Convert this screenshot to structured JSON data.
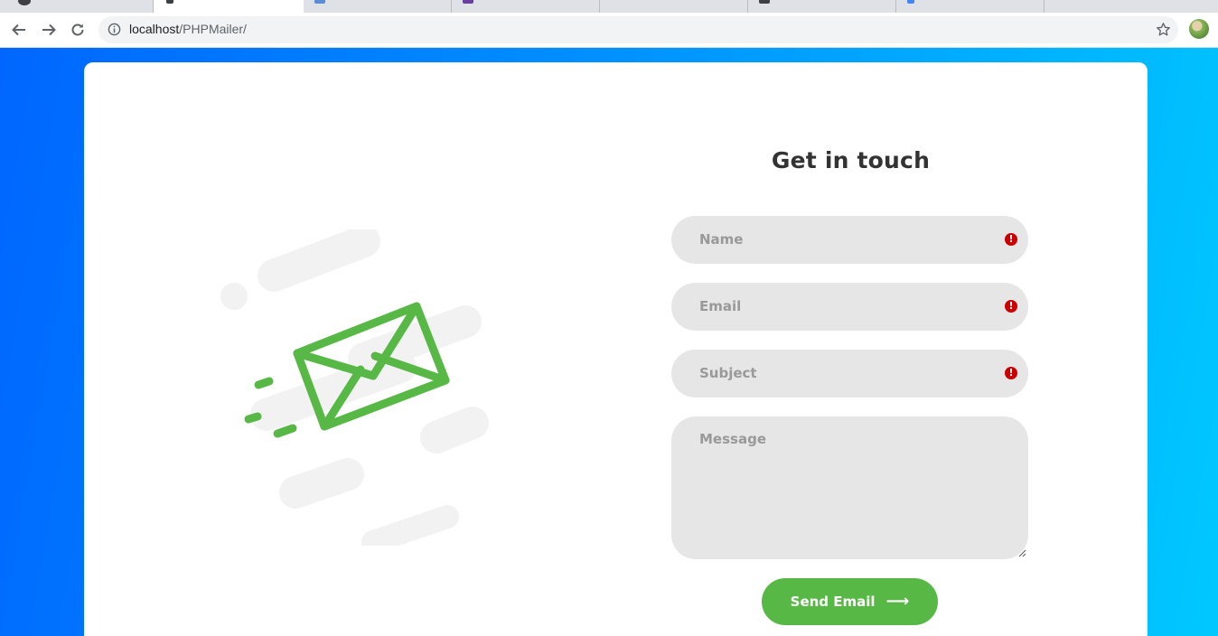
{
  "browser": {
    "address_host": "localhost",
    "address_path": "/PHPMailer/"
  },
  "form": {
    "title": "Get in touch",
    "name_placeholder": "Name",
    "email_placeholder": "Email",
    "subject_placeholder": "Subject",
    "message_placeholder": "Message",
    "send_label": "Send Email",
    "send_arrow": "⟶"
  },
  "colors": {
    "accent_green": "#57b846",
    "gradient_start": "#0066ff",
    "gradient_end": "#00c8ff",
    "field_bg": "#e6e6e6",
    "alert_red": "#cc0000"
  },
  "icons": {
    "illustration": "envelope-icon",
    "validation": "exclamation-icon"
  }
}
